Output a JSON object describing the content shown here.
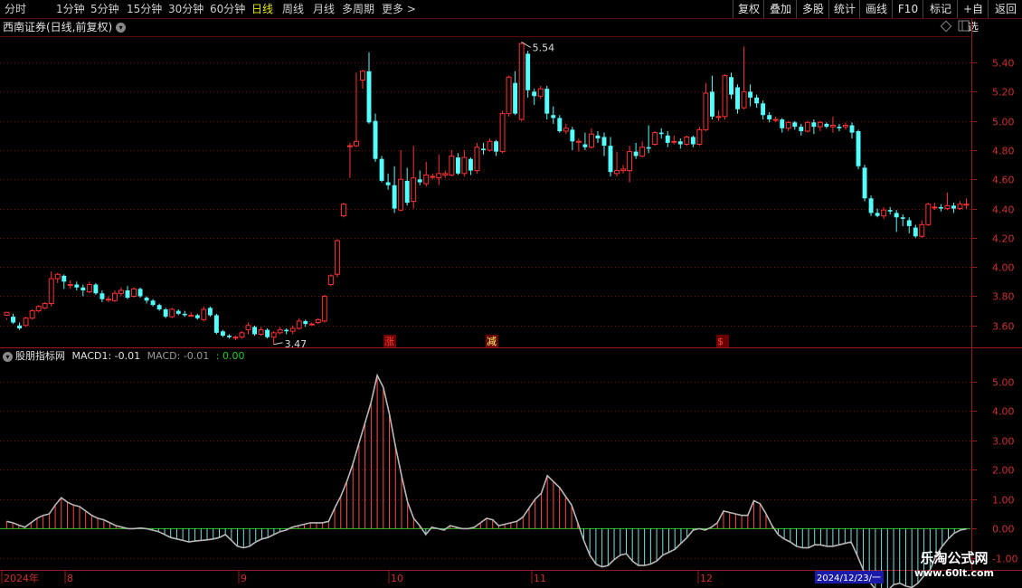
{
  "toolbar": {
    "periods": [
      "分时",
      "1分钟",
      "5分钟",
      "15分钟",
      "30分钟",
      "60分钟",
      "日线",
      "周线",
      "月线",
      "多周期",
      "更多 >"
    ],
    "active_period": "日线",
    "right_buttons": [
      "复权",
      "叠加",
      "多股",
      "统计",
      "画线",
      "F10",
      "标记",
      "+自选",
      "返回"
    ]
  },
  "price_panel": {
    "title": "西南证券(日线,前复权)",
    "price_ticks": [
      "5.40",
      "5.20",
      "5.00",
      "4.80",
      "4.60",
      "4.40",
      "4.20",
      "4.00",
      "3.80",
      "3.60"
    ],
    "high_label": "5.54",
    "low_label": "3.47",
    "markers": [
      "涨",
      "减",
      "$"
    ],
    "colors": {
      "up": "#ff3232",
      "down": "#54ffff",
      "grid": "#7a0c0c"
    }
  },
  "macd_panel": {
    "name": "股朋指标网",
    "macd1_label": "MACD1: -0.01",
    "macd_label": "MACD: -0.01",
    "zero_label": ": 0.00",
    "ticks": [
      "5.00",
      "4.00",
      "3.00",
      "2.00",
      "1.00",
      "0.00",
      "-1.00"
    ],
    "colors": {
      "pos": "#ff4a4a",
      "neg": "#7fe0e0",
      "line": "#b8b8b8",
      "zero": "#22cc22"
    }
  },
  "time_axis": {
    "labels": [
      "2024年",
      "8",
      "9",
      "10",
      "11",
      "12"
    ],
    "cursor_date": "2024/12/23/一"
  },
  "watermark": {
    "name": "乐淘公式网",
    "url": "www.60lt.com"
  },
  "chart_data": {
    "type": "candlestick",
    "title": "西南证券(日线,前复权)",
    "ylim": [
      3.45,
      5.58
    ],
    "macd_ylim": [
      -1.4,
      5.6
    ],
    "candles": [
      [
        3.67,
        3.69,
        3.65,
        3.64
      ],
      [
        3.66,
        3.62,
        3.68,
        3.61
      ],
      [
        3.6,
        3.58,
        3.62,
        3.57
      ],
      [
        3.6,
        3.65,
        3.66,
        3.59
      ],
      [
        3.65,
        3.7,
        3.71,
        3.64
      ],
      [
        3.7,
        3.73,
        3.74,
        3.69
      ],
      [
        3.72,
        3.75,
        3.76,
        3.71
      ],
      [
        3.75,
        3.92,
        3.97,
        3.73
      ],
      [
        3.92,
        3.95,
        3.96,
        3.89
      ],
      [
        3.94,
        3.9,
        3.95,
        3.85
      ],
      [
        3.88,
        3.88,
        3.91,
        3.85
      ],
      [
        3.88,
        3.86,
        3.9,
        3.84
      ],
      [
        3.86,
        3.84,
        3.88,
        3.8
      ],
      [
        3.83,
        3.88,
        3.9,
        3.82
      ],
      [
        3.88,
        3.82,
        3.89,
        3.81
      ],
      [
        3.82,
        3.78,
        3.84,
        3.76
      ],
      [
        3.78,
        3.78,
        3.8,
        3.76
      ],
      [
        3.77,
        3.82,
        3.84,
        3.76
      ],
      [
        3.82,
        3.84,
        3.86,
        3.8
      ],
      [
        3.84,
        3.79,
        3.87,
        3.78
      ],
      [
        3.8,
        3.85,
        3.86,
        3.79
      ],
      [
        3.85,
        3.8,
        3.86,
        3.79
      ],
      [
        3.79,
        3.77,
        3.8,
        3.75
      ],
      [
        3.77,
        3.74,
        3.78,
        3.73
      ],
      [
        3.74,
        3.71,
        3.75,
        3.7
      ],
      [
        3.71,
        3.66,
        3.72,
        3.65
      ],
      [
        3.66,
        3.71,
        3.72,
        3.65
      ],
      [
        3.7,
        3.68,
        3.71,
        3.67
      ],
      [
        3.68,
        3.67,
        3.7,
        3.66
      ],
      [
        3.67,
        3.67,
        3.69,
        3.66
      ],
      [
        3.67,
        3.65,
        3.68,
        3.64
      ],
      [
        3.64,
        3.71,
        3.73,
        3.63
      ],
      [
        3.72,
        3.67,
        3.73,
        3.66
      ],
      [
        3.67,
        3.55,
        3.68,
        3.54
      ],
      [
        3.56,
        3.53,
        3.57,
        3.52
      ],
      [
        3.53,
        3.52,
        3.54,
        3.51
      ],
      [
        3.52,
        3.52,
        3.53,
        3.5
      ],
      [
        3.52,
        3.55,
        3.56,
        3.51
      ],
      [
        3.57,
        3.6,
        3.62,
        3.54
      ],
      [
        3.59,
        3.54,
        3.6,
        3.53
      ],
      [
        3.54,
        3.57,
        3.59,
        3.53
      ],
      [
        3.57,
        3.52,
        3.58,
        3.51
      ],
      [
        3.52,
        3.55,
        3.56,
        3.47
      ],
      [
        3.55,
        3.57,
        3.59,
        3.54
      ],
      [
        3.57,
        3.56,
        3.58,
        3.54
      ],
      [
        3.56,
        3.58,
        3.6,
        3.54
      ],
      [
        3.58,
        3.63,
        3.65,
        3.57
      ],
      [
        3.63,
        3.61,
        3.64,
        3.59
      ],
      [
        3.61,
        3.61,
        3.62,
        3.6
      ],
      [
        3.62,
        3.64,
        3.65,
        3.61
      ],
      [
        3.63,
        3.8,
        3.81,
        3.62
      ],
      [
        3.88,
        3.94,
        3.95,
        3.87
      ],
      [
        3.95,
        4.18,
        4.19,
        3.93
      ],
      [
        4.35,
        4.43,
        4.44,
        4.34
      ],
      [
        4.83,
        4.83,
        4.85,
        4.61
      ],
      [
        4.83,
        4.86,
        5.33,
        4.82
      ],
      [
        5.28,
        5.34,
        5.35,
        5.22
      ],
      [
        5.34,
        4.99,
        5.47,
        4.98
      ],
      [
        5.0,
        4.74,
        5.05,
        4.72
      ],
      [
        4.74,
        4.59,
        4.76,
        4.58
      ],
      [
        4.58,
        4.56,
        4.64,
        4.53
      ],
      [
        4.56,
        4.4,
        4.69,
        4.37
      ],
      [
        4.39,
        4.6,
        4.8,
        4.38
      ],
      [
        4.59,
        4.44,
        4.68,
        4.42
      ],
      [
        4.45,
        4.61,
        4.83,
        4.4
      ],
      [
        4.6,
        4.58,
        4.66,
        4.56
      ],
      [
        4.57,
        4.63,
        4.72,
        4.55
      ],
      [
        4.62,
        4.62,
        4.64,
        4.6
      ],
      [
        4.61,
        4.64,
        4.77,
        4.56
      ],
      [
        4.63,
        4.64,
        4.66,
        4.61
      ],
      [
        4.63,
        4.76,
        4.8,
        4.62
      ],
      [
        4.75,
        4.64,
        4.78,
        4.63
      ],
      [
        4.64,
        4.75,
        4.8,
        4.62
      ],
      [
        4.74,
        4.66,
        4.75,
        4.63
      ],
      [
        4.66,
        4.82,
        4.85,
        4.64
      ],
      [
        4.81,
        4.8,
        4.85,
        4.77
      ],
      [
        4.8,
        4.86,
        4.88,
        4.79
      ],
      [
        4.86,
        4.79,
        4.87,
        4.76
      ],
      [
        4.79,
        5.05,
        5.07,
        4.78
      ],
      [
        5.05,
        5.3,
        5.31,
        5.03
      ],
      [
        5.26,
        5.05,
        5.34,
        5.04
      ],
      [
        5.01,
        5.53,
        5.54,
        5.0
      ],
      [
        5.46,
        5.21,
        5.48,
        5.16
      ],
      [
        5.2,
        5.17,
        5.22,
        5.11
      ],
      [
        5.17,
        5.22,
        5.24,
        5.15
      ],
      [
        5.22,
        5.05,
        5.24,
        5.01
      ],
      [
        5.04,
        5.02,
        5.1,
        4.98
      ],
      [
        5.02,
        4.93,
        5.04,
        4.92
      ],
      [
        4.93,
        4.95,
        4.98,
        4.91
      ],
      [
        4.94,
        4.86,
        4.96,
        4.8
      ],
      [
        4.86,
        4.86,
        4.88,
        4.79
      ],
      [
        4.84,
        4.82,
        4.92,
        4.8
      ],
      [
        4.82,
        4.91,
        4.95,
        4.81
      ],
      [
        4.9,
        4.88,
        4.93,
        4.85
      ],
      [
        4.89,
        4.83,
        4.92,
        4.76
      ],
      [
        4.83,
        4.65,
        4.89,
        4.62
      ],
      [
        4.64,
        4.66,
        4.79,
        4.62
      ],
      [
        4.66,
        4.67,
        4.7,
        4.64
      ],
      [
        4.66,
        4.79,
        4.83,
        4.58
      ],
      [
        4.79,
        4.76,
        4.85,
        4.74
      ],
      [
        4.76,
        4.82,
        4.86,
        4.75
      ],
      [
        4.82,
        4.81,
        4.97,
        4.78
      ],
      [
        4.84,
        4.92,
        4.93,
        4.83
      ],
      [
        4.92,
        4.91,
        4.95,
        4.88
      ],
      [
        4.9,
        4.85,
        4.93,
        4.82
      ],
      [
        4.86,
        4.86,
        4.9,
        4.84
      ],
      [
        4.86,
        4.84,
        4.88,
        4.81
      ],
      [
        4.84,
        4.89,
        4.9,
        4.83
      ],
      [
        4.89,
        4.84,
        4.9,
        4.82
      ],
      [
        4.84,
        4.94,
        4.96,
        4.83
      ],
      [
        4.94,
        5.19,
        5.26,
        4.93
      ],
      [
        5.2,
        5.03,
        5.31,
        5.01
      ],
      [
        5.03,
        5.03,
        5.07,
        5.0
      ],
      [
        5.03,
        5.31,
        5.32,
        5.01
      ],
      [
        5.3,
        5.18,
        5.33,
        5.15
      ],
      [
        5.23,
        5.08,
        5.25,
        5.05
      ],
      [
        5.09,
        5.2,
        5.51,
        5.08
      ],
      [
        5.2,
        5.16,
        5.25,
        5.1
      ],
      [
        5.16,
        5.12,
        5.18,
        5.09
      ],
      [
        5.12,
        5.04,
        5.14,
        5.01
      ],
      [
        5.04,
        5.01,
        5.06,
        4.99
      ],
      [
        5.01,
        5.01,
        5.03,
        4.99
      ],
      [
        5.01,
        4.95,
        5.02,
        4.92
      ],
      [
        4.95,
        4.99,
        5.0,
        4.93
      ],
      [
        4.99,
        4.96,
        5.0,
        4.94
      ],
      [
        4.96,
        4.93,
        4.98,
        4.9
      ],
      [
        4.93,
        4.99,
        5.0,
        4.92
      ],
      [
        4.99,
        4.96,
        5.01,
        4.91
      ],
      [
        4.96,
        4.99,
        5.0,
        4.93
      ],
      [
        4.98,
        4.96,
        4.99,
        4.95
      ],
      [
        4.96,
        4.97,
        5.03,
        4.92
      ],
      [
        4.96,
        4.95,
        4.98,
        4.93
      ],
      [
        4.96,
        4.97,
        4.99,
        4.94
      ],
      [
        4.97,
        4.92,
        4.99,
        4.88
      ],
      [
        4.93,
        4.69,
        4.94,
        4.67
      ],
      [
        4.68,
        4.47,
        4.7,
        4.45
      ],
      [
        4.47,
        4.37,
        4.49,
        4.35
      ],
      [
        4.37,
        4.35,
        4.4,
        4.34
      ],
      [
        4.35,
        4.39,
        4.41,
        4.33
      ],
      [
        4.39,
        4.38,
        4.41,
        4.36
      ],
      [
        4.37,
        4.34,
        4.39,
        4.24
      ],
      [
        4.34,
        4.33,
        4.36,
        4.28
      ],
      [
        4.32,
        4.28,
        4.34,
        4.23
      ],
      [
        4.27,
        4.21,
        4.29,
        4.2
      ],
      [
        4.21,
        4.29,
        4.32,
        4.2
      ],
      [
        4.29,
        4.43,
        4.44,
        4.28
      ],
      [
        4.41,
        4.41,
        4.44,
        4.39
      ],
      [
        4.41,
        4.4,
        4.43,
        4.38
      ],
      [
        4.4,
        4.42,
        4.51,
        4.39
      ],
      [
        4.42,
        4.4,
        4.44,
        4.37
      ],
      [
        4.4,
        4.43,
        4.45,
        4.39
      ],
      [
        4.43,
        4.43,
        4.47,
        4.4
      ]
    ],
    "macd": [
      0.25,
      0.2,
      0.12,
      0.05,
      0.2,
      0.35,
      0.45,
      0.5,
      0.8,
      1.05,
      0.9,
      0.8,
      0.75,
      0.6,
      0.45,
      0.35,
      0.3,
      0.2,
      0.1,
      0.05,
      0.0,
      0.0,
      0.02,
      0.0,
      -0.05,
      -0.1,
      -0.2,
      -0.3,
      -0.35,
      -0.4,
      -0.45,
      -0.42,
      -0.4,
      -0.38,
      -0.35,
      -0.3,
      -0.2,
      -0.4,
      -0.6,
      -0.65,
      -0.6,
      -0.45,
      -0.35,
      -0.3,
      -0.2,
      -0.1,
      -0.05,
      0.05,
      0.1,
      0.15,
      0.2,
      0.2,
      0.2,
      0.25,
      0.7,
      1.1,
      1.6,
      2.2,
      2.9,
      3.6,
      4.3,
      5.2,
      4.8,
      3.9,
      2.8,
      1.8,
      0.9,
      0.35,
      0.1,
      -0.2,
      0.05,
      0.0,
      -0.05,
      0.1,
      0.05,
      0.0,
      0.0,
      0.05,
      0.2,
      0.35,
      0.3,
      0.1,
      0.15,
      0.2,
      0.25,
      0.4,
      0.7,
      1.0,
      1.2,
      1.8,
      1.6,
      1.4,
      1.1,
      0.8,
      0.2,
      -0.4,
      -0.9,
      -1.2,
      -1.3,
      -1.25,
      -1.05,
      -0.9,
      -0.85,
      -1.1,
      -1.25,
      -1.25,
      -1.2,
      -1.1,
      -0.9,
      -0.8,
      -0.7,
      -0.5,
      -0.3,
      -0.05,
      0.0,
      -0.05,
      0.05,
      0.2,
      0.6,
      0.55,
      0.5,
      0.45,
      0.45,
      0.95,
      0.85,
      0.5,
      0.1,
      -0.2,
      -0.35,
      -0.45,
      -0.6,
      -0.65,
      -0.65,
      -0.55,
      -0.55,
      -0.6,
      -0.6,
      -0.55,
      -0.5,
      -0.45,
      -0.9,
      -1.4,
      -1.8,
      -2.05,
      -2.3,
      -2.1,
      -1.9,
      -1.85,
      -1.95,
      -2.0,
      -1.85,
      -1.6,
      -1.4,
      -0.9,
      -0.6,
      -0.35,
      -0.15,
      -0.05,
      -0.01
    ]
  }
}
